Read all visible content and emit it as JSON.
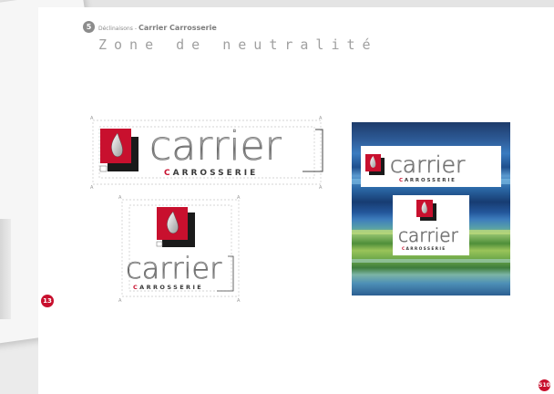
{
  "header": {
    "step_number": "5",
    "breadcrumb_prefix": "Déclinaisons",
    "breadcrumb_separator": "-",
    "brand": "Carrier Carrosserie",
    "section_title": "Zone de neutralité"
  },
  "logo": {
    "wordmark": "carrier",
    "subline_initial": "C",
    "subline_rest": "ARROSSERIE",
    "anchor_mark": "A"
  },
  "back_sheet": {
    "page_number": "13"
  },
  "footer": {
    "page_number": "S10"
  },
  "colors": {
    "brand_red": "#c8102e",
    "dark_square": "#1a1a1a",
    "chrome": "#b8b8b8"
  }
}
